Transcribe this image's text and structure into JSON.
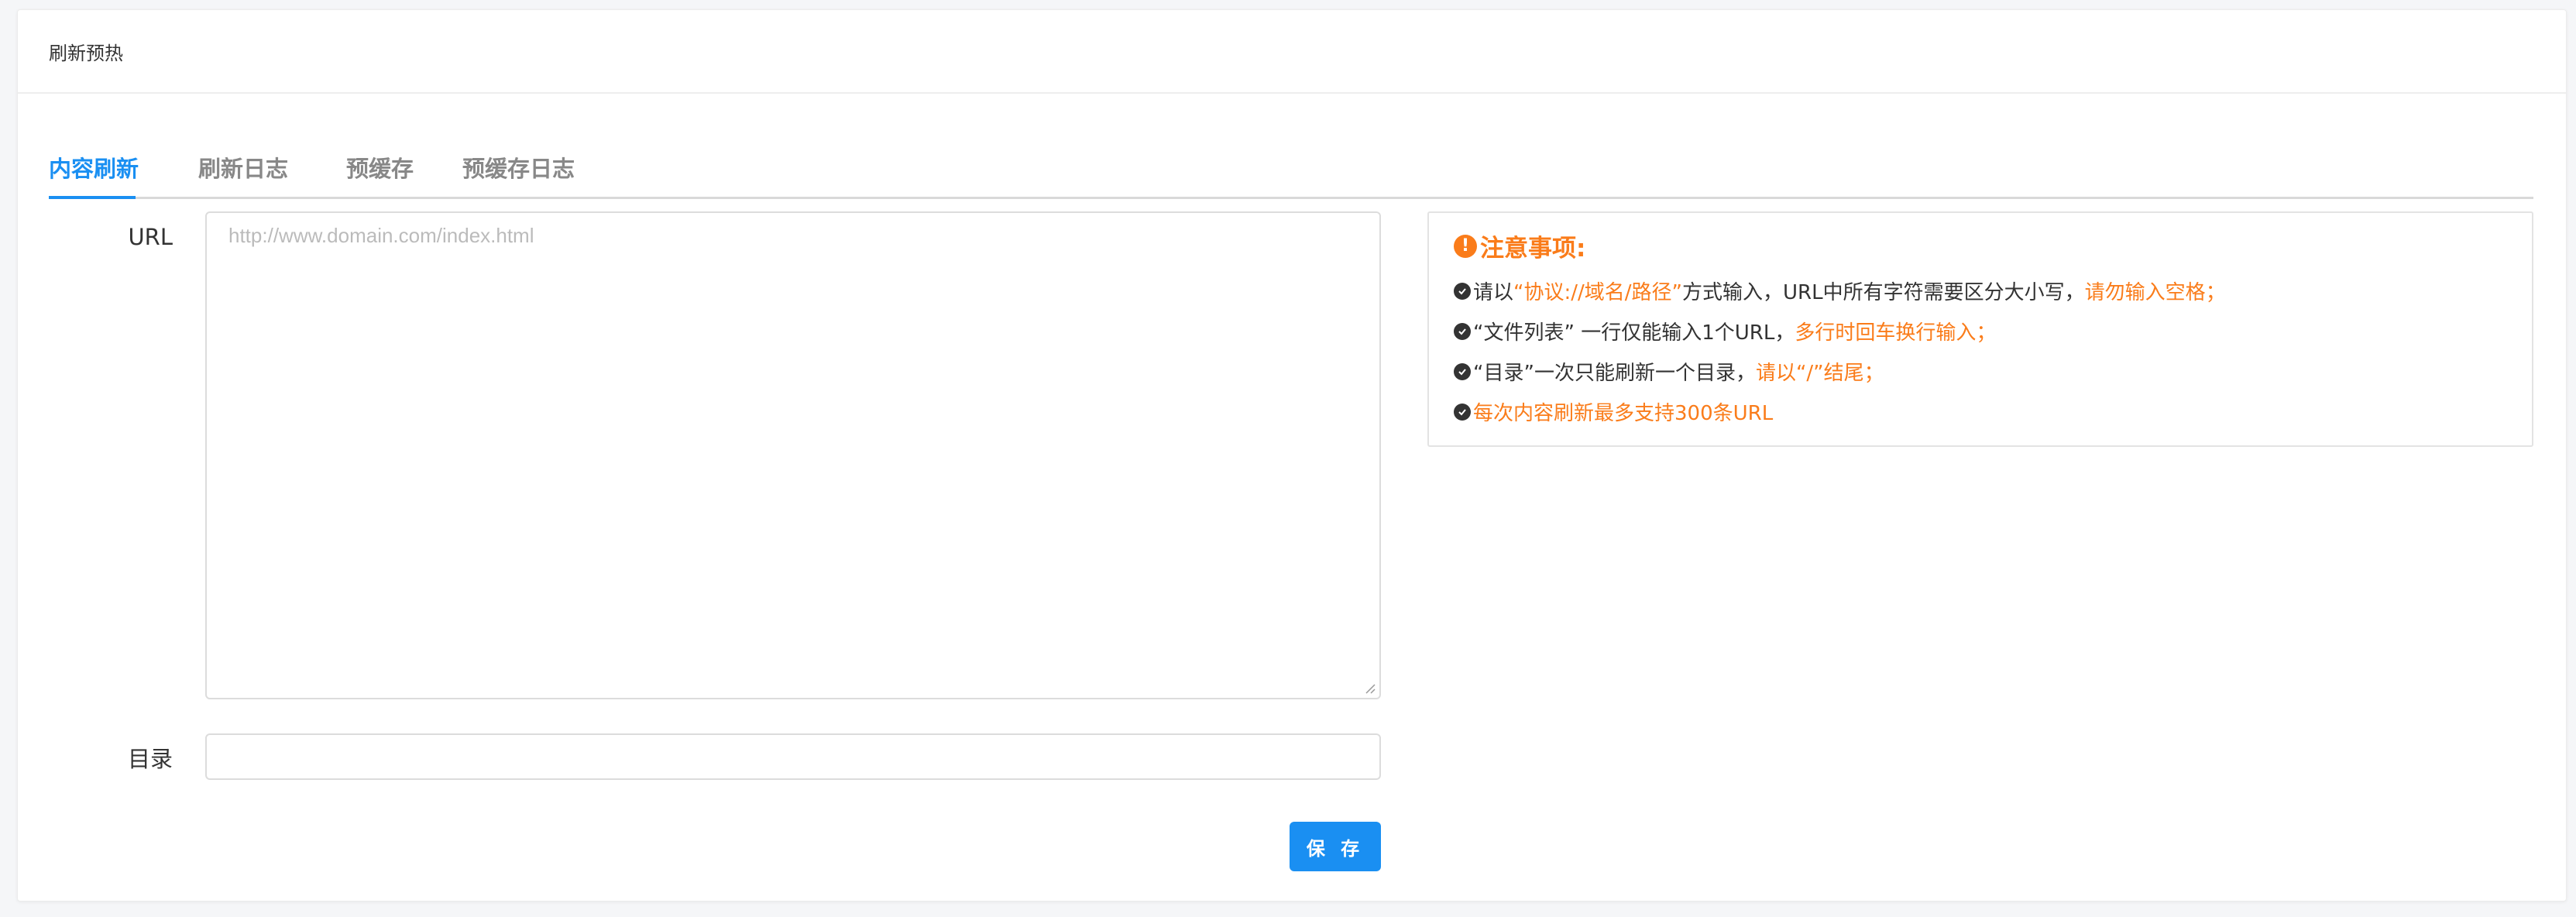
{
  "page": {
    "title": "刷新预热"
  },
  "tabs": [
    {
      "label": "内容刷新"
    },
    {
      "label": "刷新日志"
    },
    {
      "label": "预缓存"
    },
    {
      "label": "预缓存日志"
    }
  ],
  "form": {
    "url_label": "URL",
    "url_placeholder": "http://www.domain.com/index.html",
    "dir_label": "目录",
    "dir_value": "",
    "save_label": "保 存"
  },
  "notice": {
    "title": "注意事项:",
    "items": [
      {
        "prefix": "请以",
        "highlight": "“协议://域名/路径”",
        "middle": "方式输入，URL中所有字符需要区分大小写，",
        "tail": "请勿输入空格；"
      },
      {
        "prefix": "“文件列表” 一行仅能输入1个URL，",
        "tail": "多行时回车换行输入；"
      },
      {
        "prefix": "“目录”一次只能刷新一个目录，",
        "tail": "请以“/”结尾；"
      },
      {
        "tail": "每次内容刷新最多支持300条URL"
      }
    ]
  },
  "colors": {
    "accent": "#1a8ff2",
    "warning": "#fa7c1a"
  }
}
